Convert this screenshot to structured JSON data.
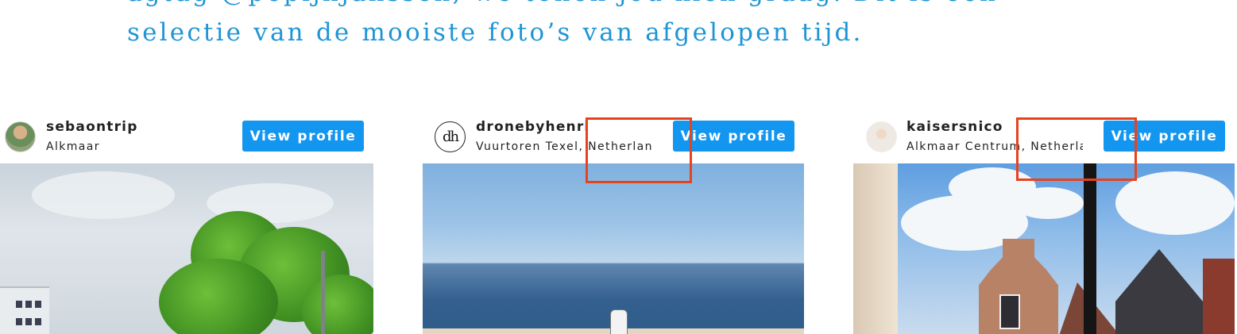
{
  "intro": {
    "line1": "agtag @pepijnjanssen, we tonen jou kiek graag. Dit is een",
    "line2": "selectie van de mooiste foto’s van afgelopen tijd."
  },
  "posts": [
    {
      "username": "sebaontrip",
      "location": "Alkmaar",
      "button": "View profile",
      "photo_icon": "photo-tree-icon"
    },
    {
      "username": "dronebyhenri",
      "avatar_text": "dh",
      "location": "Vuurtoren Texel, Netherlands",
      "button": "View profile",
      "photo_icon": "photo-sea-icon"
    },
    {
      "username": "kaisersnico",
      "location": "Alkmaar Centrum, Netherlands",
      "button": "View profile",
      "photo_icon": "photo-gable-icon"
    }
  ],
  "colors": {
    "accent": "#1396f0",
    "intro_text": "#1f95d6",
    "highlight": "#e8421d"
  }
}
